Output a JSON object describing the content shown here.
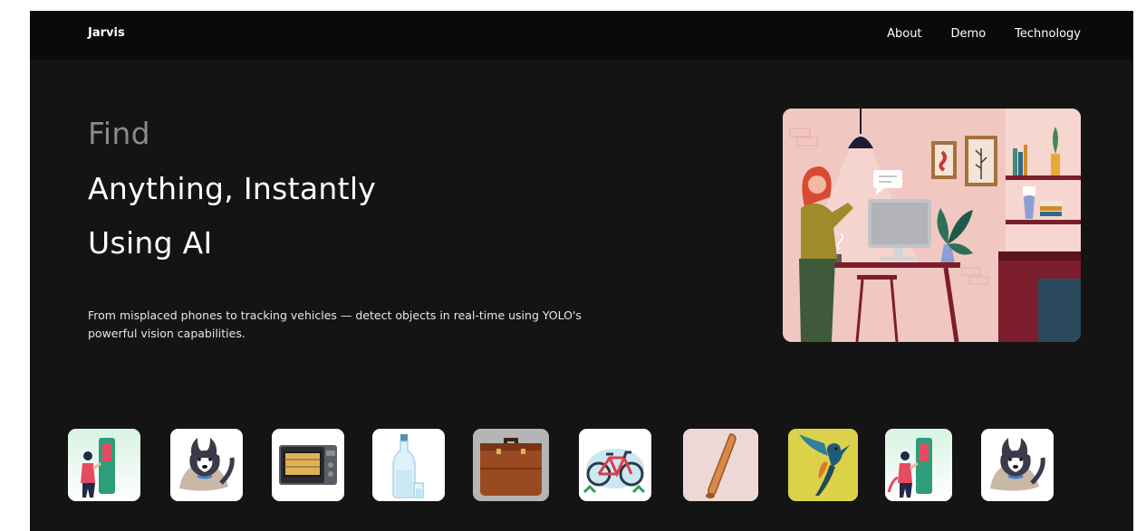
{
  "navbar": {
    "brand": "Jarvis",
    "links": [
      {
        "label": "About"
      },
      {
        "label": "Demo"
      },
      {
        "label": "Technology"
      }
    ]
  },
  "hero": {
    "find": "Find",
    "line2": "Anything, Instantly",
    "line3": "Using AI",
    "description": "From misplaced phones to tracking vehicles — detect objects in real-time using YOLO's powerful vision capabilities."
  },
  "colors": {
    "page_bg": "#141414",
    "navbar_bg": "#0a0a0a",
    "muted_heading": "#8a8a8a",
    "heading": "#ffffff"
  },
  "object_cards": [
    {
      "icon": "person-kiosk-icon"
    },
    {
      "icon": "dog-icon"
    },
    {
      "icon": "microwave-icon"
    },
    {
      "icon": "bottle-icon"
    },
    {
      "icon": "suitcase-icon"
    },
    {
      "icon": "bicycle-icon"
    },
    {
      "icon": "baseball-bat-icon"
    },
    {
      "icon": "bird-icon"
    },
    {
      "icon": "person-kiosk-icon"
    },
    {
      "icon": "dog-icon"
    }
  ]
}
